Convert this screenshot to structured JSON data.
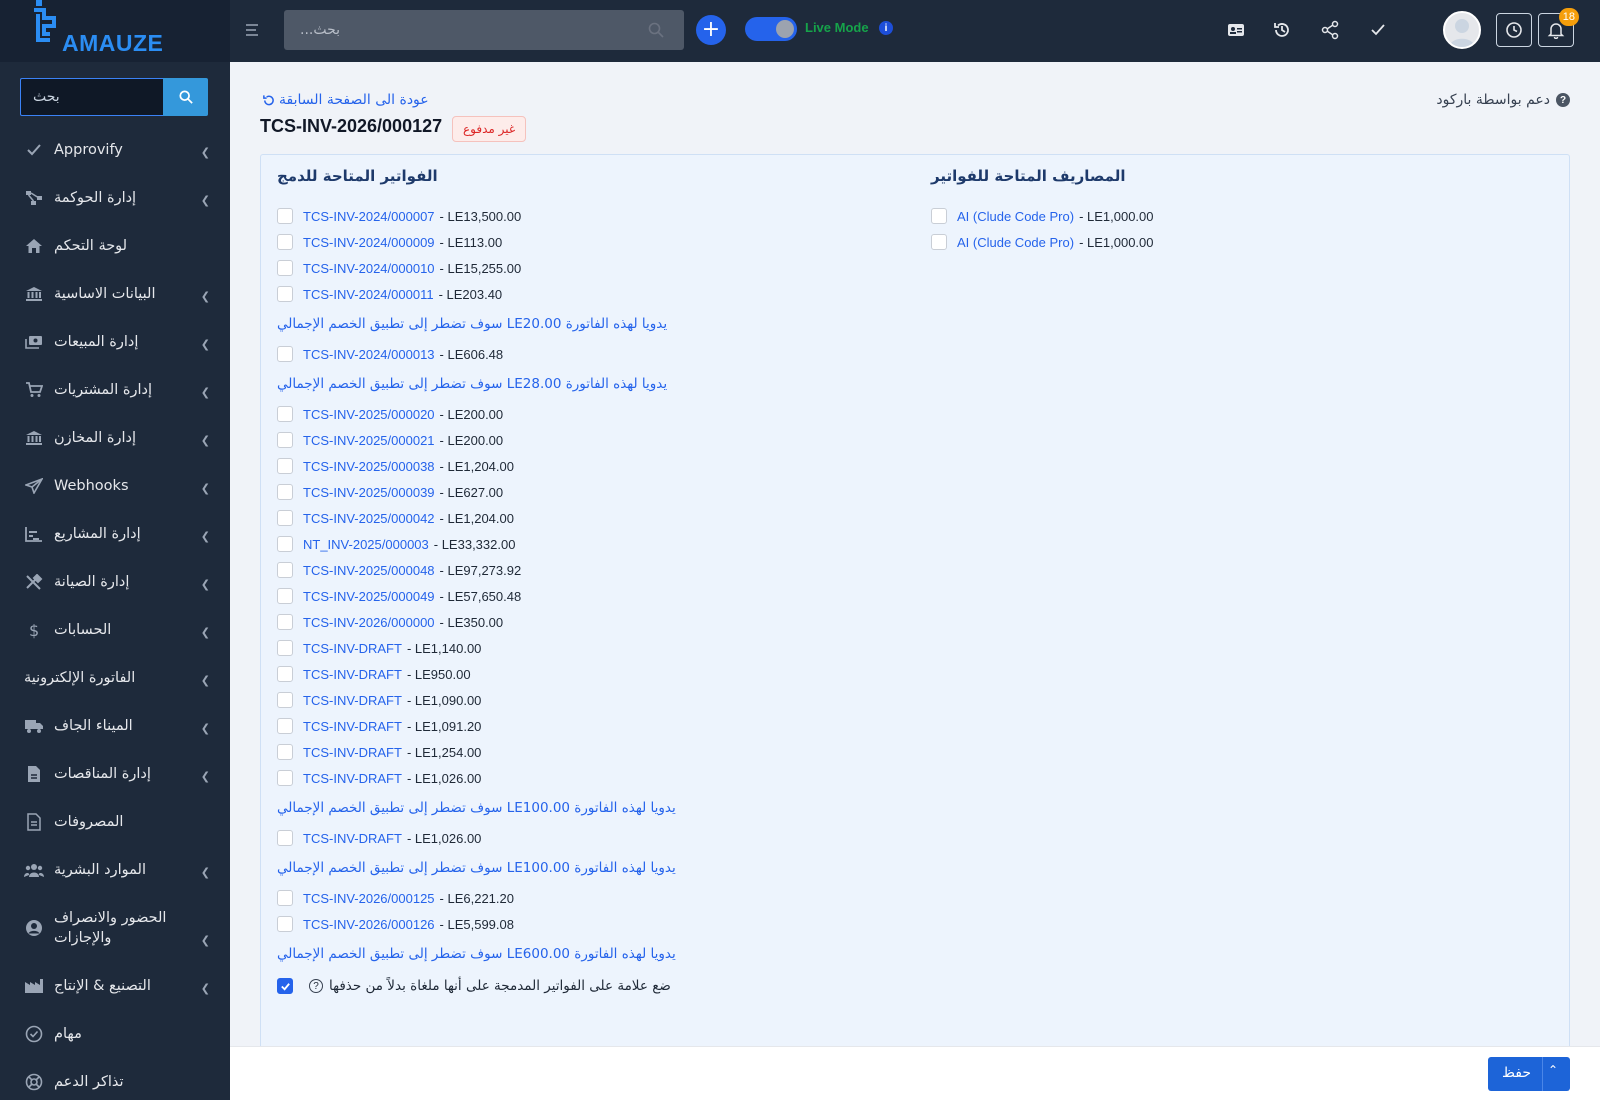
{
  "brand": {
    "logo_text": "AMAUZE"
  },
  "sidebar": {
    "search_placeholder": "بحث",
    "items": [
      {
        "label": "Approvify",
        "icon": "check-icon",
        "chevron": true
      },
      {
        "label": "إدارة الحوكمة",
        "icon": "sitemap-icon",
        "chevron": true
      },
      {
        "label": "لوحة التحكم",
        "icon": "home-icon",
        "chevron": false
      },
      {
        "label": "البيانات الاساسية",
        "icon": "bank-icon",
        "chevron": true
      },
      {
        "label": "إدارة المبيعات",
        "icon": "cash-icon",
        "chevron": true
      },
      {
        "label": "إدارة المشتريات",
        "icon": "cart-icon",
        "chevron": true
      },
      {
        "label": "إدارة المخازن",
        "icon": "warehouse-icon",
        "chevron": true
      },
      {
        "label": "Webhooks",
        "icon": "send-icon",
        "chevron": true
      },
      {
        "label": "إدارة المشاريع",
        "icon": "chart-icon",
        "chevron": true
      },
      {
        "label": "إدارة الصيانة",
        "icon": "tools-icon",
        "chevron": true
      },
      {
        "label": "الحسابات",
        "icon": "dollar-icon",
        "chevron": true
      },
      {
        "label": "الفاتورة الإلكترونية",
        "icon": "",
        "chevron": true
      },
      {
        "label": "الميناء الجاف",
        "icon": "truck-icon",
        "chevron": true
      },
      {
        "label": "إدارة المناقصات",
        "icon": "file-icon",
        "chevron": true
      },
      {
        "label": "المصروفات",
        "icon": "receipt-icon",
        "chevron": false
      },
      {
        "label": "الموارد البشرية",
        "icon": "users-icon",
        "chevron": true
      },
      {
        "label": "الحضور والانصراف والإجازات",
        "icon": "user-circle-icon",
        "chevron": true,
        "tall": true
      },
      {
        "label": "التصنيع & الإنتاج",
        "icon": "factory-icon",
        "chevron": true
      },
      {
        "label": "مهام",
        "icon": "check-circle-icon",
        "chevron": false
      },
      {
        "label": "تذاكر الدعم",
        "icon": "lifebuoy-icon",
        "chevron": false
      }
    ]
  },
  "topbar": {
    "search_placeholder": "بحث...",
    "live_mode_label": "Live Mode",
    "live_mode_on": true,
    "notifications_count": "18"
  },
  "page": {
    "back_label": "عودة الى الصفحة السابقة",
    "barcode_help": "دعم بواسطة باركود",
    "invoice_number": "TCS-INV-2026/000127",
    "status": "غير مدفوع",
    "merge_title": "الفواتير المتاحة للدمج",
    "expenses_title": "المصاريف المتاحة للفواتير",
    "left_entries": [
      {
        "type": "inv",
        "number": "TCS-INV-2024/000007",
        "amount": "- LE13,500.00"
      },
      {
        "type": "inv",
        "number": "TCS-INV-2024/000009",
        "amount": "- LE113.00"
      },
      {
        "type": "inv",
        "number": "TCS-INV-2024/000010",
        "amount": "- LE15,255.00"
      },
      {
        "type": "inv",
        "number": "TCS-INV-2024/000011",
        "amount": "- LE203.40"
      },
      {
        "type": "note",
        "text": "يدويا لهذه الفاتورة LE20.00 سوف تضطر إلى تطبيق الخصم الإجمالي"
      },
      {
        "type": "inv",
        "number": "TCS-INV-2024/000013",
        "amount": "- LE606.48"
      },
      {
        "type": "note",
        "text": "يدويا لهذه الفاتورة LE28.00 سوف تضطر إلى تطبيق الخصم الإجمالي"
      },
      {
        "type": "inv",
        "number": "TCS-INV-2025/000020",
        "amount": "- LE200.00"
      },
      {
        "type": "inv",
        "number": "TCS-INV-2025/000021",
        "amount": "- LE200.00"
      },
      {
        "type": "inv",
        "number": "TCS-INV-2025/000038",
        "amount": "- LE1,204.00"
      },
      {
        "type": "inv",
        "number": "TCS-INV-2025/000039",
        "amount": "- LE627.00"
      },
      {
        "type": "inv",
        "number": "TCS-INV-2025/000042",
        "amount": "- LE1,204.00"
      },
      {
        "type": "inv",
        "number": "NT_INV-2025/000003",
        "amount": "- LE33,332.00"
      },
      {
        "type": "inv",
        "number": "TCS-INV-2025/000048",
        "amount": "- LE97,273.92"
      },
      {
        "type": "inv",
        "number": "TCS-INV-2025/000049",
        "amount": "- LE57,650.48"
      },
      {
        "type": "inv",
        "number": "TCS-INV-2026/000000",
        "amount": "- LE350.00"
      },
      {
        "type": "inv",
        "number": "TCS-INV-DRAFT",
        "amount": "- LE1,140.00"
      },
      {
        "type": "inv",
        "number": "TCS-INV-DRAFT",
        "amount": "- LE950.00"
      },
      {
        "type": "inv",
        "number": "TCS-INV-DRAFT",
        "amount": "- LE1,090.00"
      },
      {
        "type": "inv",
        "number": "TCS-INV-DRAFT",
        "amount": "- LE1,091.20"
      },
      {
        "type": "inv",
        "number": "TCS-INV-DRAFT",
        "amount": "- LE1,254.00"
      },
      {
        "type": "inv",
        "number": "TCS-INV-DRAFT",
        "amount": "- LE1,026.00"
      },
      {
        "type": "note",
        "text": "يدويا لهذه الفاتورة LE100.00 سوف تضطر إلى تطبيق الخصم الإجمالي"
      },
      {
        "type": "inv",
        "number": "TCS-INV-DRAFT",
        "amount": "- LE1,026.00"
      },
      {
        "type": "note",
        "text": "يدويا لهذه الفاتورة LE100.00 سوف تضطر إلى تطبيق الخصم الإجمالي"
      },
      {
        "type": "inv",
        "number": "TCS-INV-2026/000125",
        "amount": "- LE6,221.20"
      },
      {
        "type": "inv",
        "number": "TCS-INV-2026/000126",
        "amount": "- LE5,599.08"
      },
      {
        "type": "note",
        "text": "يدويا لهذه الفاتورة LE600.00 سوف تضطر إلى تطبيق الخصم الإجمالي"
      }
    ],
    "mark_cancelled_label": "ضع علامة على الفواتير المدمجة على أنها ملغاة بدلاً من حذفها",
    "mark_cancelled_checked": true,
    "expenses": [
      {
        "name": "AI (Clude Code Pro)",
        "amount": "- LE1,000.00"
      },
      {
        "name": "AI (Clude Code Pro)",
        "amount": "- LE1,000.00"
      }
    ]
  },
  "footer": {
    "save_label": "حفظ"
  }
}
